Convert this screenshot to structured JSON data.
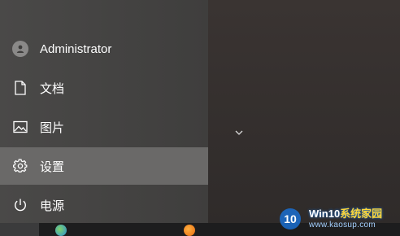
{
  "start_menu": {
    "items": [
      {
        "label": "Administrator",
        "icon": "user-avatar-icon"
      },
      {
        "label": "文档",
        "icon": "document-icon"
      },
      {
        "label": "图片",
        "icon": "pictures-icon"
      },
      {
        "label": "设置",
        "icon": "gear-icon"
      },
      {
        "label": "电源",
        "icon": "power-icon"
      }
    ],
    "hovered_item": "设置"
  },
  "expand_icon": "chevron-down-icon",
  "watermark": {
    "logo_text": "10",
    "brand_main": "Win10",
    "brand_accent": "系统家园",
    "url": "www.kaosup.com"
  },
  "colors": {
    "hover_bg": "#6a6968",
    "text": "#ffffff",
    "taskbar": "#1d1d1e"
  }
}
